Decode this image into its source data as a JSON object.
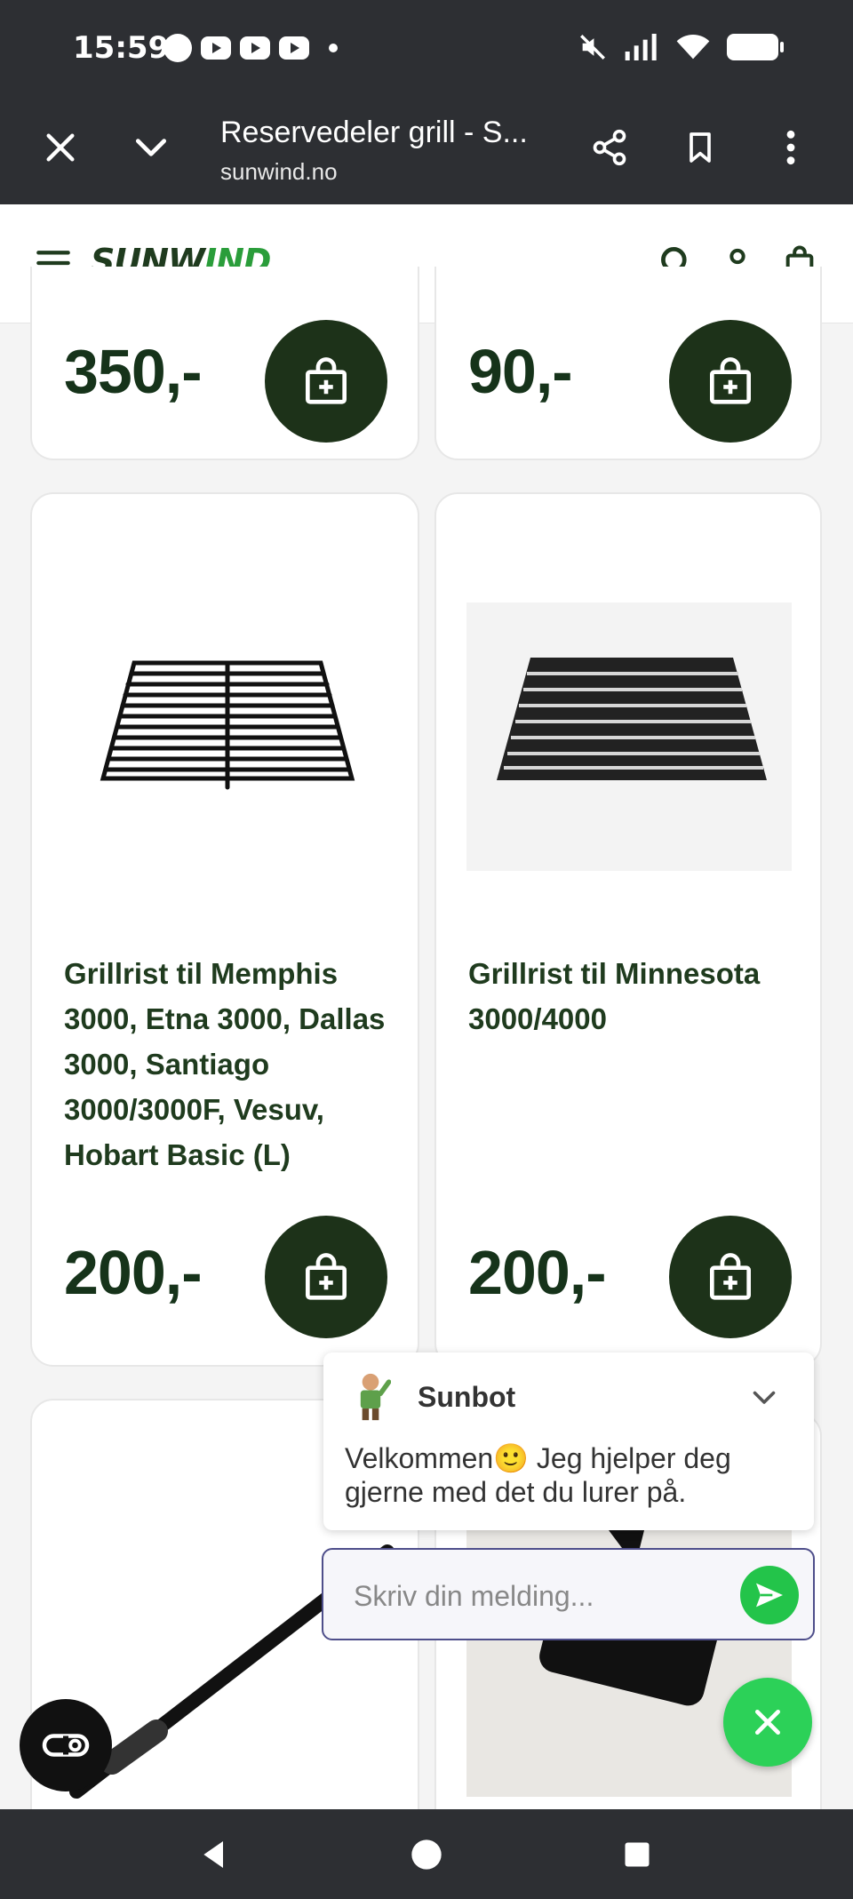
{
  "status_bar": {
    "time": "15:59",
    "coop_label": "coop"
  },
  "browser": {
    "title": "Reservedeler grill - S...",
    "url": "sunwind.no"
  },
  "site": {
    "logo_main": "SUNW",
    "logo_accent": "IND"
  },
  "products": [
    {
      "price": "350,-"
    },
    {
      "price": "90,-"
    },
    {
      "title": "Grillrist til Memphis 3000, Etna 3000, Dallas 3000, Santiago 3000/3000F, Vesuv, Hobart Basic (L)",
      "price": "200,-"
    },
    {
      "title": "Grillrist til Minnesota 3000/4000",
      "price": "200,-"
    }
  ],
  "chat": {
    "bot_name": "Sunbot",
    "welcome_message": "Velkommen🙂 Jeg hjelper deg gjerne med det du lurer på.",
    "input_placeholder": "Skriv din melding..."
  },
  "colors": {
    "chrome_dark": "#2d2f33",
    "brand_dark_green": "#1d3219",
    "price_green": "#16331a",
    "chat_green": "#2cd158"
  }
}
